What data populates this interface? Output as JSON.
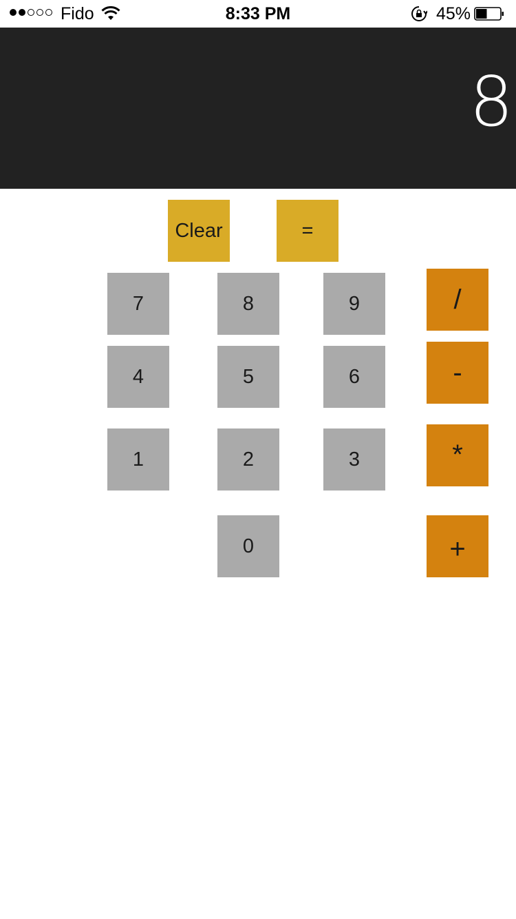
{
  "status_bar": {
    "carrier": "Fido",
    "time": "8:33 PM",
    "battery_percent": "45%",
    "signal_bars_filled": 2,
    "signal_bars_total": 5,
    "battery_level": 0.45,
    "icons": [
      "wifi-icon",
      "rotation-lock-icon",
      "battery-icon"
    ]
  },
  "display": {
    "value": "8"
  },
  "actions": {
    "clear_label": "Clear",
    "equals_label": "="
  },
  "digits": {
    "seven": "7",
    "eight": "8",
    "nine": "9",
    "four": "4",
    "five": "5",
    "six": "6",
    "one": "1",
    "two": "2",
    "three": "3",
    "zero": "0"
  },
  "operators": {
    "divide": "/",
    "subtract": "-",
    "multiply": "*",
    "add": "+"
  },
  "colors": {
    "display_bg": "#222222",
    "digit_bg": "#aaaaaa",
    "action_bg": "#d9ab27",
    "operator_bg": "#d4820f"
  }
}
